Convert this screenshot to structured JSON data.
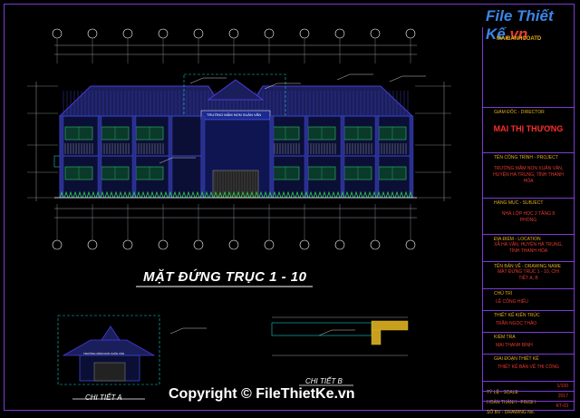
{
  "logo": {
    "text": "File Thiết Kế",
    "suffix": ".vn",
    "tagline": "MAIBANHCOATD"
  },
  "drawing": {
    "main_title": "MẶT ĐỨNG TRỤC 1 - 10",
    "detail_a": "CHI TIẾT A",
    "detail_b": "CHI TIẾT B",
    "sign_main": "TRƯỜNG MẦM NON XUÂN VĂN",
    "sign_a": "TRƯỜNG MẦM NON XUÂN VĂN"
  },
  "title_block": {
    "owner_header": "GIÁM ĐỐC - DIRECTOR",
    "owner_name": "MAI THỊ THƯƠNG",
    "project_header": "TÊN CÔNG TRÌNH - PROJECT",
    "project_value": "TRƯỜNG MẦM NON XUÂN VĂN, HUYỆN HÀ TRUNG, TỈNH THANH HÓA",
    "subject_header": "HẠNG MỤC - SUBJECT",
    "subject_value": "NHÀ LỚP HỌC 2 TẦNG 8 PHÒNG",
    "location_header": "ĐỊA ĐIỂM - LOCATION",
    "location_value": "XÃ HÀ VÂN, HUYỆN HÀ TRUNG, TỈNH THANH HÓA",
    "drawing_header": "TÊN BẢN VẼ - DRAWING NAME",
    "drawing_value": "MẶT ĐỨNG TRỤC 1 - 10, CHI TIẾT A, B",
    "role1_header": "CHỦ TRÌ",
    "role1_value": "LÊ CÔNG HIẾU",
    "role2_header": "THIẾT KẾ KIẾN TRÚC",
    "role2_value": "TRẦN NGỌC THẢO",
    "role3_header": "KIỂM TRA",
    "role3_value": "MAI THANH BÌNH",
    "stage_header": "GIAI ĐOẠN THIẾT KẾ",
    "stage_value": "THIẾT KẾ BẢN VẼ THI CÔNG",
    "scale_label": "TỶ LỆ - SCALE",
    "scale_value": "1/100",
    "date_label": "HOÀN THÀNH - FINISH",
    "date_value": "2017",
    "sheet_label": "SỐ BV - DRAWING No.",
    "sheet_value": "KT-03"
  },
  "watermark": "Copyright © FileThietKe.vn",
  "colors": {
    "frame": "#7c3ad8",
    "roof": "#4a3ad8",
    "wall": "#3b46d6",
    "grass": "#2fd04a",
    "dim": "#9aa0a8",
    "red": "#e8392f",
    "yellow": "#e0b01a"
  }
}
